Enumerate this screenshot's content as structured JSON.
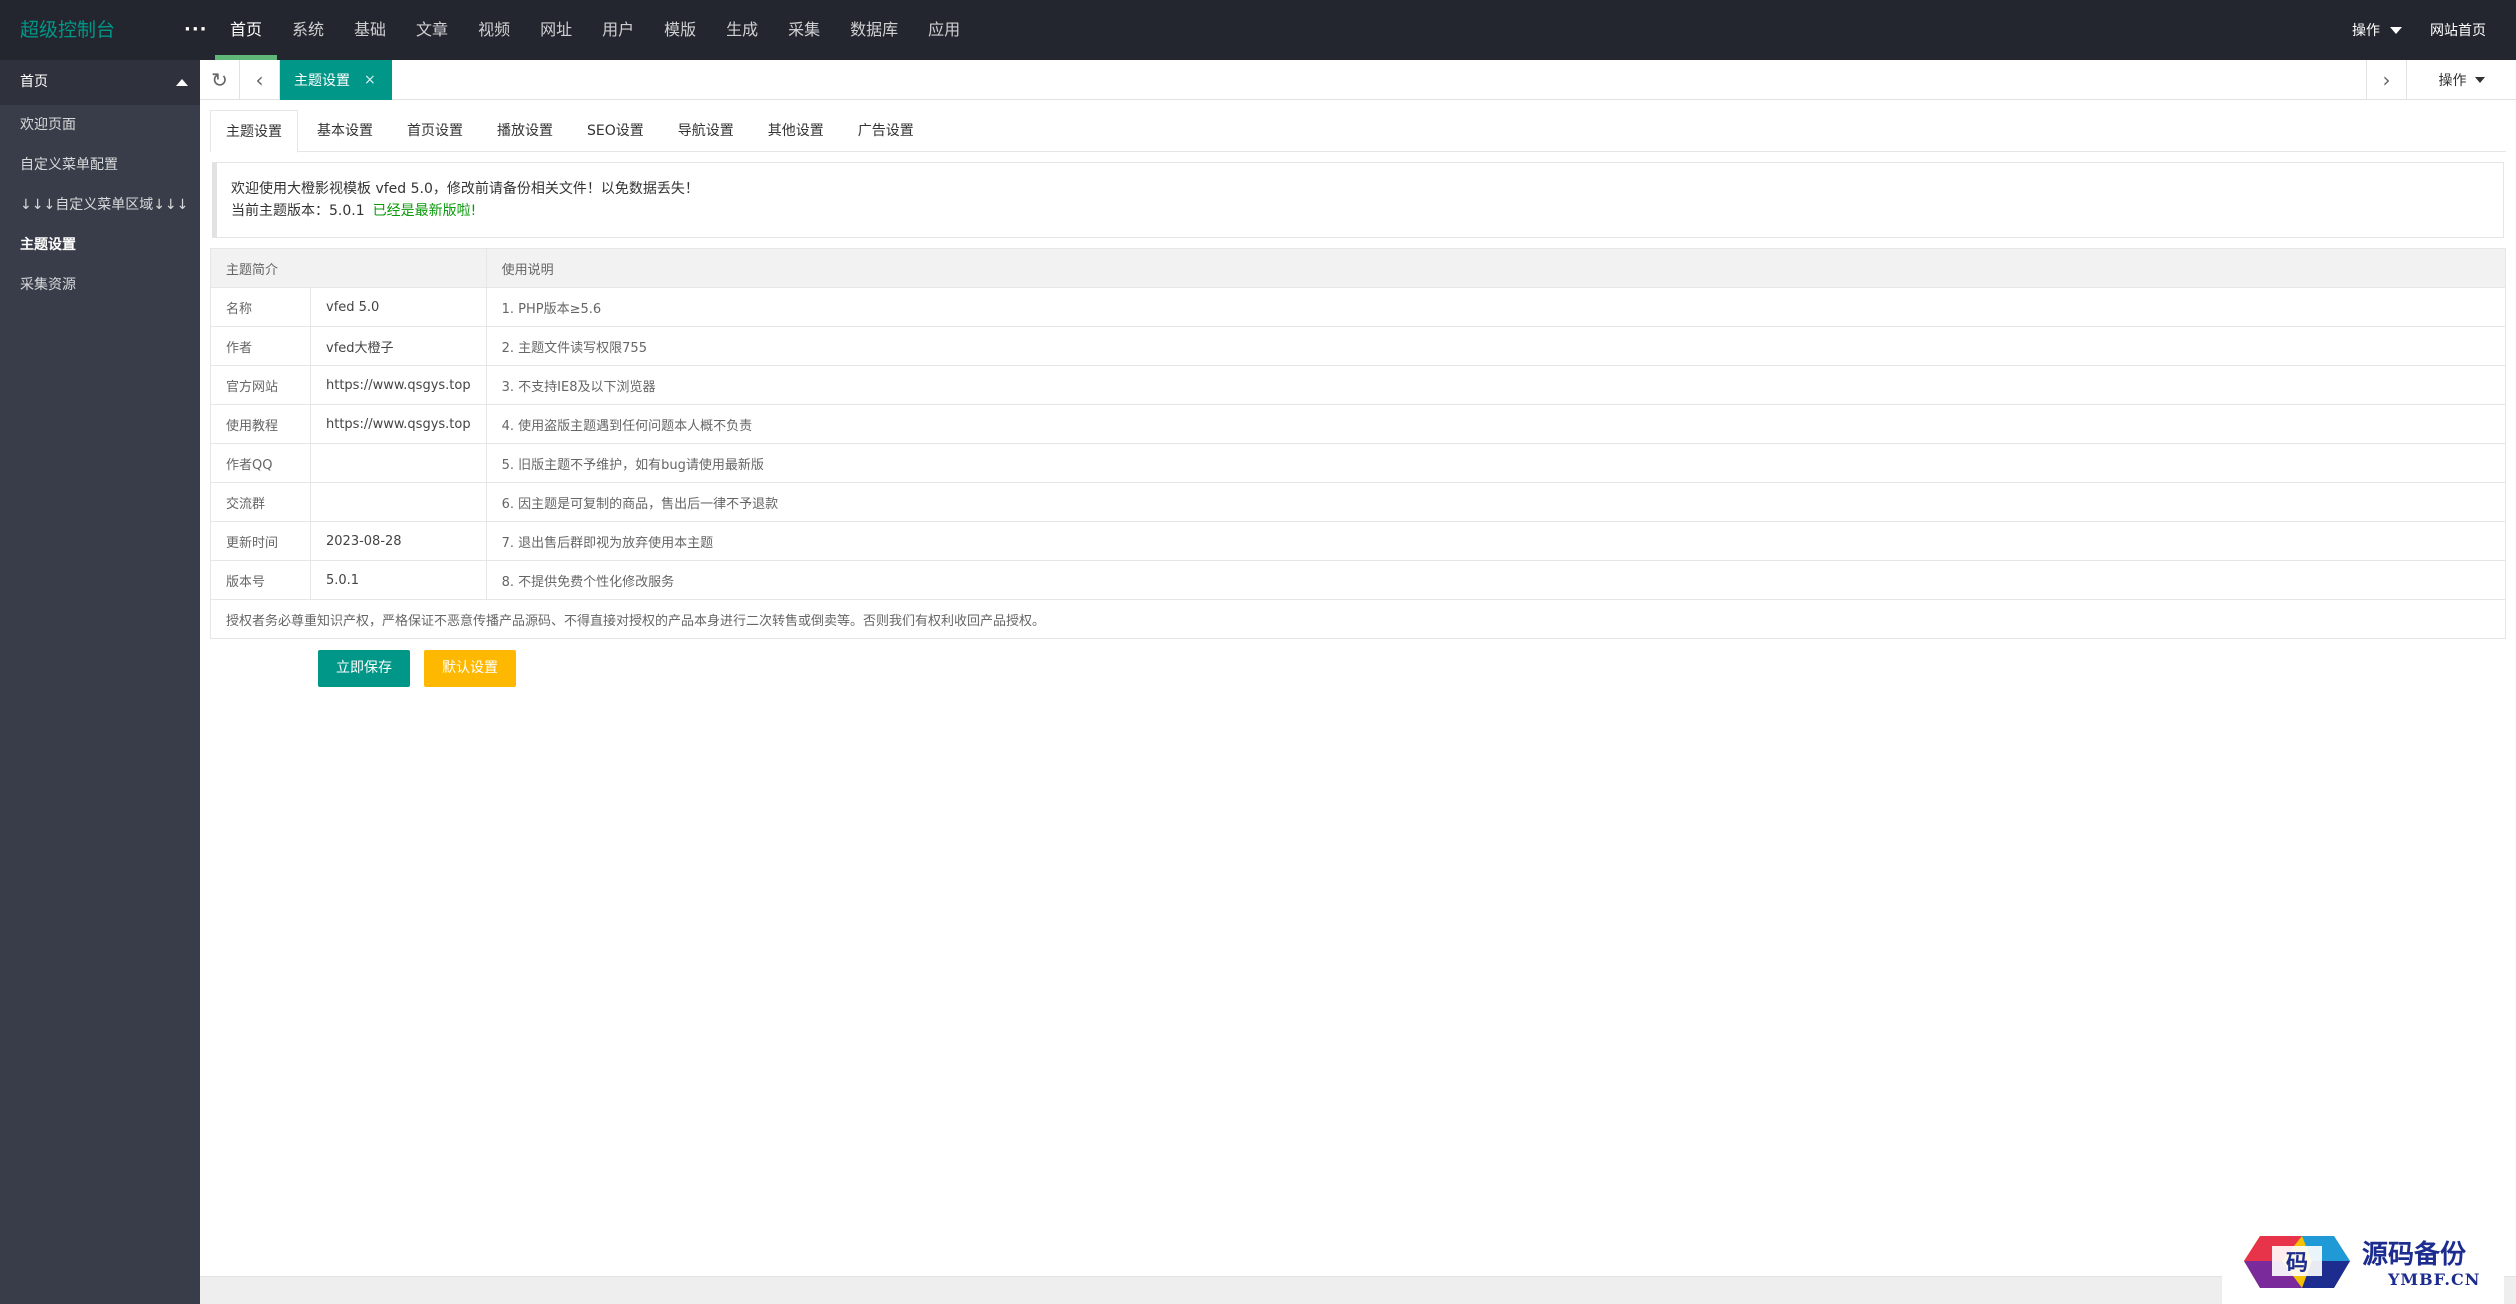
{
  "header": {
    "logo": "超级控制台",
    "more": "···",
    "nav": [
      "首页",
      "系统",
      "基础",
      "文章",
      "视频",
      "网址",
      "用户",
      "模版",
      "生成",
      "采集",
      "数据库",
      "应用"
    ],
    "operation": "操作",
    "site_home": "网站首页"
  },
  "sidebar": {
    "group": "首页",
    "items": [
      "欢迎页面",
      "自定义菜单配置",
      "↓↓↓自定义菜单区域↓↓↓",
      "主题设置",
      "采集资源"
    ]
  },
  "tabbar": {
    "active_tab": "主题设置",
    "close": "×",
    "operation": "操作"
  },
  "subtabs": [
    "主题设置",
    "基本设置",
    "首页设置",
    "播放设置",
    "SEO设置",
    "导航设置",
    "其他设置",
    "广告设置"
  ],
  "notice": {
    "line1": "欢迎使用大橙影视模板 vfed 5.0，修改前请备份相关文件！以免数据丢失！",
    "line2_prefix": "当前主题版本：5.0.1",
    "latest": "已经是最新版啦!"
  },
  "table": {
    "head_intro": "主题简介",
    "head_usage": "使用说明",
    "rows": [
      {
        "label": "名称",
        "value": "vfed 5.0",
        "note": "1. PHP版本≥5.6"
      },
      {
        "label": "作者",
        "value": "vfed大橙子",
        "note": "2. 主题文件读写权限755"
      },
      {
        "label": "官方网站",
        "value": "https://www.qsgys.top",
        "note": "3. 不支持IE8及以下浏览器"
      },
      {
        "label": "使用教程",
        "value": "https://www.qsgys.top",
        "note": "4. 使用盗版主题遇到任何问题本人概不负责"
      },
      {
        "label": "作者QQ",
        "value": "",
        "note": "5. 旧版主题不予维护，如有bug请使用最新版"
      },
      {
        "label": "交流群",
        "value": "",
        "note": "6. 因主题是可复制的商品，售出后一律不予退款"
      },
      {
        "label": "更新时间",
        "value": "2023-08-28",
        "note": "7. 退出售后群即视为放弃使用本主题"
      },
      {
        "label": "版本号",
        "value": "5.0.1",
        "note": "8. 不提供免费个性化修改服务"
      }
    ],
    "footer": "授权者务必尊重知识产权，严格保证不恶意传播产品源码、不得直接对授权的产品本身进行二次转售或倒卖等。否则我们有权利收回产品授权。"
  },
  "buttons": {
    "save": "立即保存",
    "default": "默认设置"
  },
  "watermark": {
    "cn": "源码备份",
    "en": "YMBF.CN",
    "glyph": "码"
  },
  "colors": {
    "header_bg": "#23262e",
    "sidebar_bg": "#393d49",
    "accent": "#009688",
    "warm": "#ffb800",
    "nav_active_bar": "#5fb878"
  }
}
